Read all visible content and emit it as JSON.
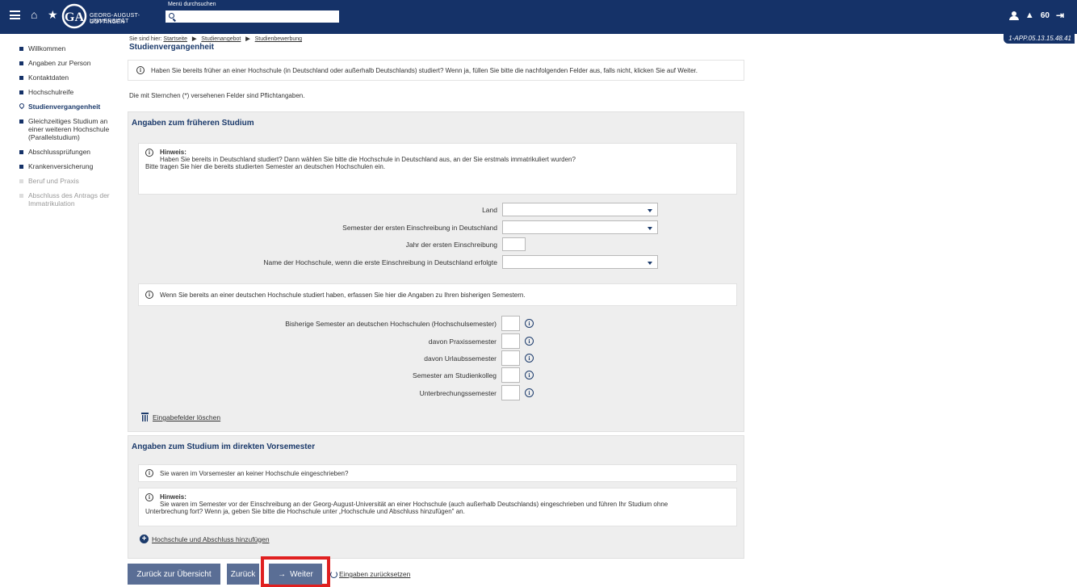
{
  "header": {
    "logo_line1": "GEORG-AUGUST-UNIVERSITÄT",
    "logo_line2": "GÖTTINGEN",
    "logo_mark": "GA",
    "menu_search_label": "Menü durchsuchen",
    "menu_search_placeholder": "",
    "session_timer": "60",
    "session_id": "1-APP.05.13.15.48.41",
    "icons": [
      "menu-icon",
      "home-icon",
      "star-icon",
      "user-icon",
      "bell-icon",
      "logout-icon"
    ]
  },
  "breadcrumb": {
    "prefix": "Sie sind hier:",
    "items": [
      "Startseite",
      "Studienangebot",
      "Studienbewerbung"
    ]
  },
  "page_title": "Studienvergangenheit",
  "sidebar": {
    "items": [
      {
        "label": "Willkommen",
        "state": "normal"
      },
      {
        "label": "Angaben zur Person",
        "state": "normal"
      },
      {
        "label": "Kontaktdaten",
        "state": "normal"
      },
      {
        "label": "Hochschulreife",
        "state": "normal"
      },
      {
        "label": "Studienvergangenheit",
        "state": "active"
      },
      {
        "label": "Gleichzeitiges Studium an einer weiteren Hochschule (Parallelstudium)",
        "state": "normal"
      },
      {
        "label": "Abschlussprüfungen",
        "state": "normal"
      },
      {
        "label": "Krankenversicherung",
        "state": "normal"
      },
      {
        "label": "Beruf und Praxis",
        "state": "disabled"
      },
      {
        "label": "Abschluss des Antrags der Immatrikulation",
        "state": "disabled"
      }
    ]
  },
  "banner_text": "Haben Sie bereits früher an einer Hochschule (in Deutschland oder außerhalb Deutschlands) studiert? Wenn ja, füllen Sie bitte die nachfolgenden Felder aus, falls nicht, klicken Sie auf Weiter.",
  "required_note": "Die mit Sternchen (*) versehenen Felder sind Pflichtangaben.",
  "section1": {
    "title": "Angaben zum früheren Studium",
    "hint_title": "Hinweis:",
    "hint_line1": "Haben Sie bereits in Deutschland studiert? Dann wählen Sie bitte die Hochschule in Deutschland aus, an der Sie erstmals immatrikuliert wurden?",
    "hint_line2": "Bitte tragen Sie hier die bereits studierten Semester an deutschen Hochschulen ein.",
    "fields": {
      "land_label": "Land",
      "land_value": "",
      "semester_first_label": "Semester der ersten Einschreibung in Deutschland",
      "semester_first_value": "",
      "year_first_label": "Jahr der ersten Einschreibung",
      "year_first_value": "",
      "university_label": "Name der Hochschule, wenn die erste Einschreibung in Deutschland erfolgte",
      "university_value": ""
    },
    "semesters_info": "Wenn Sie bereits an einer deutschen Hochschule studiert haben, erfassen Sie hier die Angaben zu Ihren bisherigen Semestern.",
    "semester_fields": [
      {
        "label": "Bisherige Semester an deutschen Hochschulen (Hochschulsemester)",
        "value": ""
      },
      {
        "label": "davon Praxissemester",
        "value": ""
      },
      {
        "label": "davon Urlaubssemester",
        "value": ""
      },
      {
        "label": "Semester am Studienkolleg",
        "value": ""
      },
      {
        "label": "Unterbrechungssemester",
        "value": ""
      }
    ],
    "clear_link": "Eingabefelder löschen"
  },
  "section2": {
    "title": "Angaben zum Studium im direkten Vorsemester",
    "info": "Sie waren im Vorsemester an keiner Hochschule eingeschrieben?",
    "hint_title": "Hinweis:",
    "hint_line1": "Sie waren im Semester vor der Einschreibung an der Georg-August-Universität an einer Hochschule (auch außerhalb Deutschlands) eingeschrieben und führen Ihr Studium ohne",
    "hint_line2": "Unterbrechung fort? Wenn ja, geben Sie bitte die Hochschule unter „Hochschule und Abschluss hinzufügen\" an.",
    "add_link": "Hochschule und Abschluss hinzufügen"
  },
  "buttons": {
    "back_overview": "Zurück zur Übersicht",
    "back": "Zurück",
    "next": "Weiter",
    "reset": "Eingaben zurücksetzen"
  },
  "colors": {
    "header_bg": "#153268",
    "panel_bg": "#eeeeee",
    "button_bg": "#5a6e95",
    "highlight": "#e02020"
  }
}
